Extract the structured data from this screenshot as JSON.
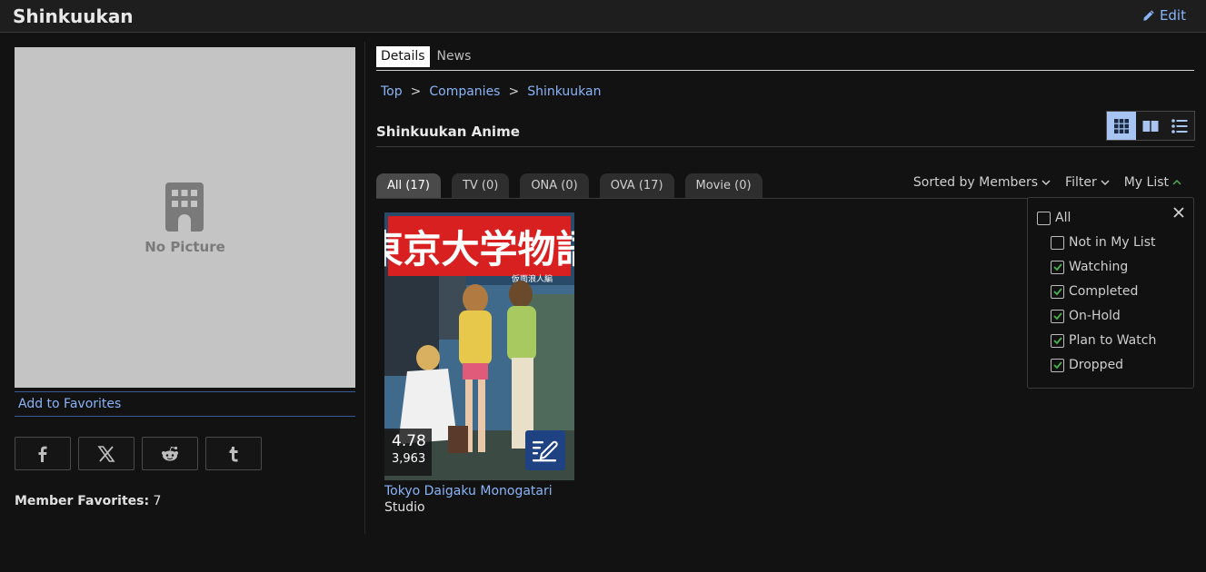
{
  "header": {
    "title": "Shinkuukan",
    "edit_label": "Edit"
  },
  "left": {
    "no_picture_label": "No Picture",
    "add_favorites": "Add to Favorites",
    "share_icons": [
      "facebook-icon",
      "x-icon",
      "reddit-icon",
      "tumblr-icon"
    ],
    "member_favorites_label": "Member Favorites:",
    "member_favorites_count": "7"
  },
  "tabs": [
    {
      "label": "Details",
      "active": true
    },
    {
      "label": "News",
      "active": false
    }
  ],
  "breadcrumb": {
    "items": [
      "Top",
      "Companies",
      "Shinkuukan"
    ],
    "separator": ">"
  },
  "section": {
    "title": "Shinkuukan Anime"
  },
  "view_modes": [
    "grid-tile-icon",
    "grid-large-icon",
    "list-icon"
  ],
  "filter_tabs": [
    {
      "label": "All (17)",
      "active": true
    },
    {
      "label": "TV (0)",
      "active": false
    },
    {
      "label": "ONA (0)",
      "active": false
    },
    {
      "label": "OVA (17)",
      "active": false
    },
    {
      "label": "Movie (0)",
      "active": false
    }
  ],
  "sortbar": {
    "sort_label": "Sorted by Members",
    "filter_label": "Filter",
    "mylist_label": "My List"
  },
  "card": {
    "cover_title_jp": "東京大学物語",
    "cover_subtitle_jp": "仮面浪人編",
    "score": "4.78",
    "members": "3,963",
    "title": "Tokyo Daigaku Monogatari",
    "studio": "Studio"
  },
  "mylist_filter": {
    "all_label": "All",
    "all_checked": false,
    "options": [
      {
        "label": "Not in My List",
        "checked": false
      },
      {
        "label": "Watching",
        "checked": true
      },
      {
        "label": "Completed",
        "checked": true
      },
      {
        "label": "On-Hold",
        "checked": true
      },
      {
        "label": "Plan to Watch",
        "checked": true
      },
      {
        "label": "Dropped",
        "checked": true
      }
    ]
  },
  "colors": {
    "accent_link": "#8ab4f8",
    "check_green": "#4caf50",
    "edit_btn": "#1f4283",
    "view_active": "#a8c4f0"
  }
}
